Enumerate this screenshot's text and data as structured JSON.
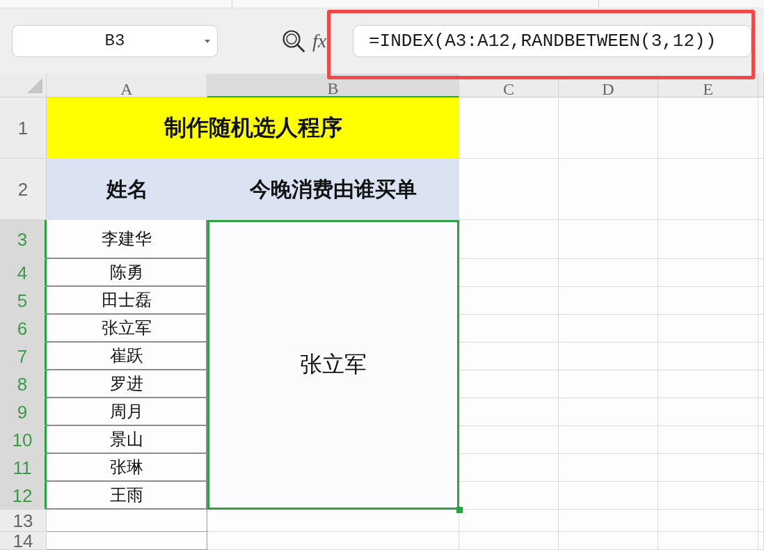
{
  "formula_bar": {
    "name_box": "B3",
    "function_label": "fx",
    "formula": "=INDEX(A3:A12,RANDBETWEEN(3,12))",
    "highlighted": true
  },
  "columns": [
    {
      "label": "A",
      "selected": false
    },
    {
      "label": "B",
      "selected": true
    },
    {
      "label": "C",
      "selected": false
    },
    {
      "label": "D",
      "selected": false
    },
    {
      "label": "E",
      "selected": false
    }
  ],
  "rows": [
    {
      "label": "1",
      "selected": false
    },
    {
      "label": "2",
      "selected": false
    },
    {
      "label": "3",
      "selected": true
    },
    {
      "label": "4",
      "selected": true
    },
    {
      "label": "5",
      "selected": true
    },
    {
      "label": "6",
      "selected": true
    },
    {
      "label": "7",
      "selected": true
    },
    {
      "label": "8",
      "selected": true
    },
    {
      "label": "9",
      "selected": true
    },
    {
      "label": "10",
      "selected": true
    },
    {
      "label": "11",
      "selected": true
    },
    {
      "label": "12",
      "selected": true
    },
    {
      "label": "13",
      "selected": false
    },
    {
      "label": "14",
      "selected": false
    }
  ],
  "sheet": {
    "title": "制作随机选人程序",
    "headers": [
      "姓名",
      "今晚消费由谁买单"
    ],
    "names": [
      "李建华",
      "陈勇",
      "田士磊",
      "张立军",
      "崔跃",
      "罗进",
      "周月",
      "景山",
      "张琳",
      "王雨"
    ],
    "result": {
      "value": "张立军",
      "selected": true
    }
  }
}
